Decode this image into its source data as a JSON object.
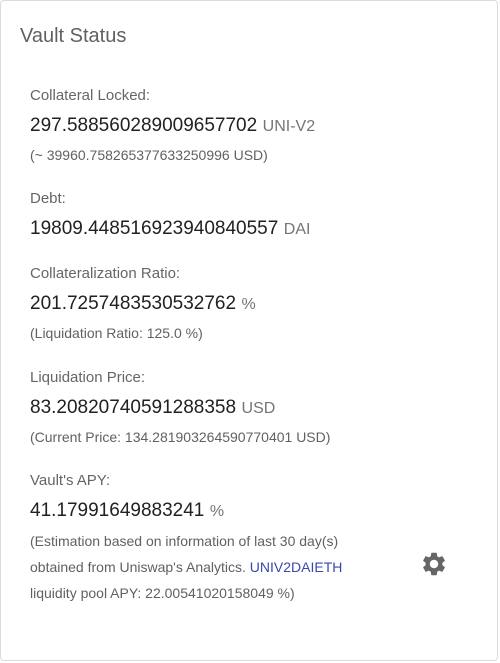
{
  "card": {
    "title": "Vault Status"
  },
  "collateral": {
    "label": "Collateral Locked:",
    "value": "297.588560289009657702",
    "unit": "UNI-V2",
    "usd_note": "(~ 39960.758265377633250996 USD)"
  },
  "debt": {
    "label": "Debt:",
    "value": "19809.448516923940840557",
    "unit": "DAI"
  },
  "collateralization": {
    "label": "Collateralization Ratio:",
    "value": "201.7257483530532762",
    "unit": "%",
    "liquidation_note": "(Liquidation Ratio: 125.0 %)"
  },
  "liquidation_price": {
    "label": "Liquidation Price:",
    "value": "83.20820740591288358",
    "unit": "USD",
    "current_note": "(Current Price: 134.281903264590770401 USD)"
  },
  "apy": {
    "label": "Vault's APY:",
    "value": "41.17991649883241",
    "unit": "%",
    "note_line1": "(Estimation based on information of last 30 day(s)",
    "note_line2_prefix": "obtained from Uniswap's Analytics.",
    "pool_link": "UNIV2DAIETH",
    "note_line3": "liquidity pool APY: 22.00541020158049 %)"
  },
  "icons": {
    "settings": "gear-icon"
  },
  "colors": {
    "link": "#3949ab",
    "gear": "#666666"
  }
}
